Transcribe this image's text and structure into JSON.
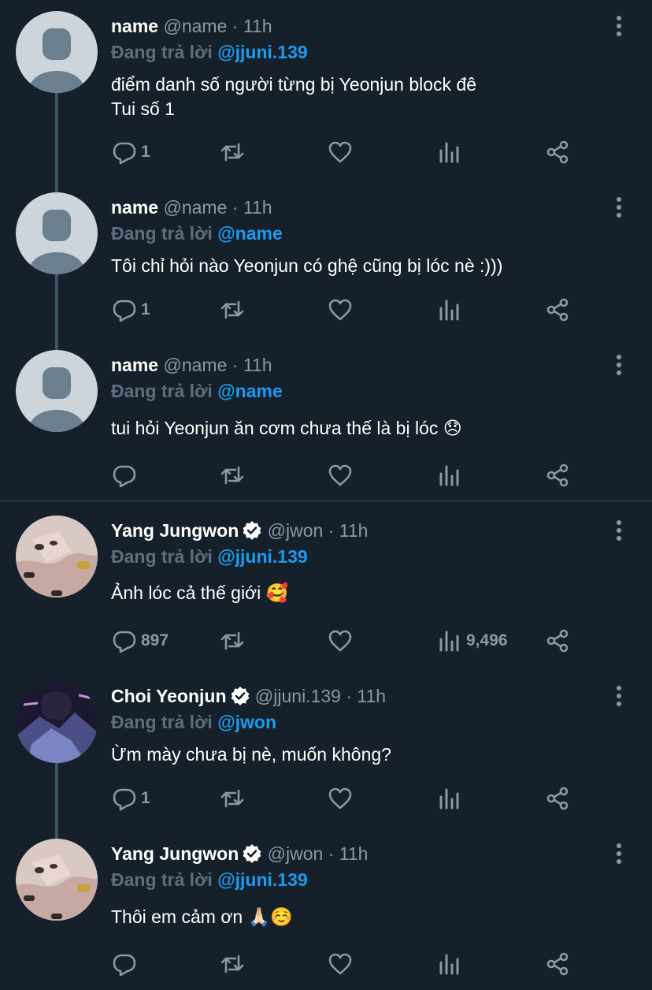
{
  "tweets": [
    {
      "name": "name",
      "handle": "@name",
      "time": "11h",
      "reply_prefix": "Đang trả lời",
      "reply_to": "@jjuni.139",
      "text": "điểm danh số người từng bị Yeonjun block đê\nTui số 1",
      "replies": "1",
      "views": ""
    },
    {
      "name": "name",
      "handle": "@name",
      "time": "11h",
      "reply_prefix": "Đang trả lời",
      "reply_to": "@name",
      "text": "Tôi chỉ hỏi nào Yeonjun có ghệ cũng bị lóc nè :)))",
      "replies": "1",
      "views": ""
    },
    {
      "name": "name",
      "handle": "@name",
      "time": "11h",
      "reply_prefix": "Đang trả lời",
      "reply_to": "@name",
      "text": "tui hỏi Yeonjun ăn cơm chưa thế là bị lóc 😞",
      "replies": "",
      "views": ""
    },
    {
      "name": "Yang Jungwon",
      "handle": "@jwon",
      "time": "11h",
      "reply_prefix": "Đang trả lời",
      "reply_to": "@jjuni.139",
      "text": "Ảnh lóc cả thế giới 🥰",
      "replies": "897",
      "views": "9,496"
    },
    {
      "name": "Choi Yeonjun",
      "handle": "@jjuni.139",
      "time": "11h",
      "reply_prefix": "Đang trả lời",
      "reply_to": "@jwon",
      "text": "Ừm mày chưa bị nè, muốn không?",
      "replies": "1",
      "views": ""
    },
    {
      "name": "Yang Jungwon",
      "handle": "@jwon",
      "time": "11h",
      "reply_prefix": "Đang trả lời",
      "reply_to": "@jjuni.139",
      "text": "Thôi em cảm ơn 🙏🏻☺️",
      "replies": "",
      "views": ""
    }
  ],
  "separator": "·",
  "colors": {
    "background": "#15202b",
    "text": "#ffffff",
    "muted": "#8899a6",
    "mention": "#1d9bf0",
    "verified": "#ffffff",
    "divider": "#38444d"
  },
  "icons": [
    "default-avatar-icon",
    "verified-badge-icon",
    "more-options-icon",
    "reply-icon",
    "retweet-icon",
    "like-icon",
    "views-icon",
    "share-icon"
  ]
}
